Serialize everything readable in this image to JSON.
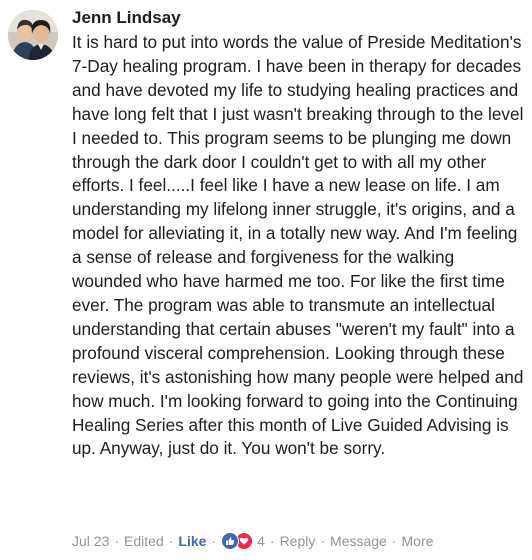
{
  "comment": {
    "author": "Jenn Lindsay",
    "text": "It is hard to put into words the value of Preside Meditation's 7-Day healing program. I have been in therapy for decades and have devoted my life to studying healing practices and have long felt that I just wasn't breaking through to the level I needed to. This program seems to be plunging me down through the dark door I couldn't get to with all my other efforts. I feel.....I feel like I have a new lease on life. I am understanding my lifelong inner struggle, it's origins, and a model for alleviating it, in a totally new way. And I'm feeling a sense of release and forgiveness for the walking wounded who have harmed me too. For like the first time ever. The program was able to transmute an intellectual understanding that certain abuses \"weren't my fault\" into a profound visceral comprehension. Looking through these reviews, it's astonishing how many people were helped and how much. I'm looking forward to going into the Continuing Healing Series after this month of Live Guided Advising is up. Anyway, just do it. You won't be sorry."
  },
  "actions": {
    "date": "Jul 23",
    "edited": "Edited",
    "like": "Like",
    "reaction_icons": [
      "like-icon",
      "love-icon"
    ],
    "reaction_count": "4",
    "reply": "Reply",
    "message": "Message",
    "more": "More",
    "separator": "·"
  },
  "colors": {
    "like_blue": "#4267b2",
    "love_red": "#f0284a",
    "meta_gray": "#90949c",
    "text": "#1c1e21"
  }
}
